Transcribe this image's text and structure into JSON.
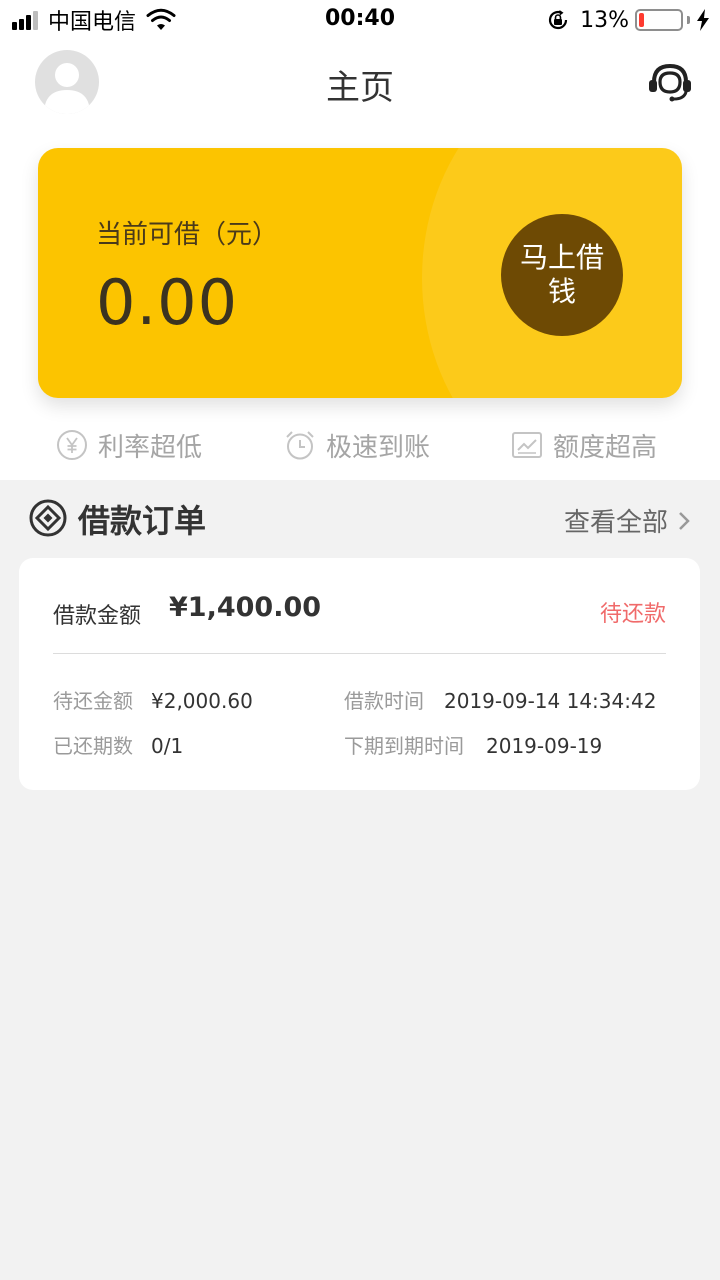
{
  "status_bar": {
    "carrier": "中国电信",
    "time": "00:40",
    "battery": "13%",
    "battery_level": 0.13
  },
  "nav": {
    "title": "主页",
    "avatar_icon": "avatar-placeholder-icon",
    "support_icon": "headset-icon"
  },
  "credit": {
    "label": "当前可借（元）",
    "amount": "0.00",
    "borrow_button": "马上借钱",
    "card_color": "#fcc400",
    "button_color": "#6e4a04"
  },
  "features": [
    {
      "label": "利率超低",
      "icon": "yen-circle-icon"
    },
    {
      "label": "极速到账",
      "icon": "alarm-clock-icon"
    },
    {
      "label": "额度超高",
      "icon": "chart-icon"
    }
  ],
  "orders": {
    "title": "借款订单",
    "view_all": "查看全部",
    "item": {
      "amount_label": "借款金额",
      "amount": "¥1,400.00",
      "status": "待还款",
      "status_color": "#f06a6a",
      "pending_label": "待还金额",
      "pending_value": "¥2,000.60",
      "time_label": "借款时间",
      "time_value": "2019-09-14 14:34:42",
      "installments_label": "已还期数",
      "installments_value": "0/1",
      "next_due_label": "下期到期时间",
      "next_due_value": "2019-09-19"
    }
  }
}
